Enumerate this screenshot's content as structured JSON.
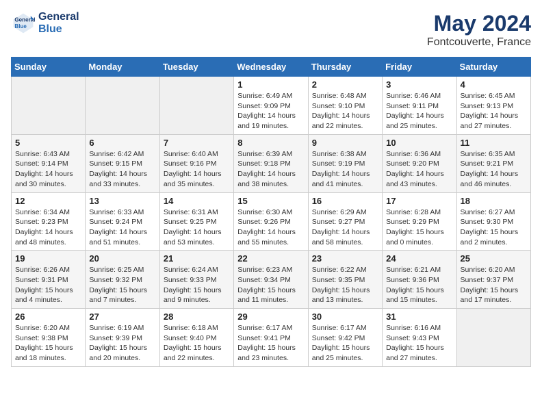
{
  "header": {
    "logo_line1": "General",
    "logo_line2": "Blue",
    "month_year": "May 2024",
    "location": "Fontcouverte, France"
  },
  "days_of_week": [
    "Sunday",
    "Monday",
    "Tuesday",
    "Wednesday",
    "Thursday",
    "Friday",
    "Saturday"
  ],
  "weeks": [
    [
      {
        "day": "",
        "sunrise": "",
        "sunset": "",
        "daylight": ""
      },
      {
        "day": "",
        "sunrise": "",
        "sunset": "",
        "daylight": ""
      },
      {
        "day": "",
        "sunrise": "",
        "sunset": "",
        "daylight": ""
      },
      {
        "day": "1",
        "sunrise": "Sunrise: 6:49 AM",
        "sunset": "Sunset: 9:09 PM",
        "daylight": "Daylight: 14 hours and 19 minutes."
      },
      {
        "day": "2",
        "sunrise": "Sunrise: 6:48 AM",
        "sunset": "Sunset: 9:10 PM",
        "daylight": "Daylight: 14 hours and 22 minutes."
      },
      {
        "day": "3",
        "sunrise": "Sunrise: 6:46 AM",
        "sunset": "Sunset: 9:11 PM",
        "daylight": "Daylight: 14 hours and 25 minutes."
      },
      {
        "day": "4",
        "sunrise": "Sunrise: 6:45 AM",
        "sunset": "Sunset: 9:13 PM",
        "daylight": "Daylight: 14 hours and 27 minutes."
      }
    ],
    [
      {
        "day": "5",
        "sunrise": "Sunrise: 6:43 AM",
        "sunset": "Sunset: 9:14 PM",
        "daylight": "Daylight: 14 hours and 30 minutes."
      },
      {
        "day": "6",
        "sunrise": "Sunrise: 6:42 AM",
        "sunset": "Sunset: 9:15 PM",
        "daylight": "Daylight: 14 hours and 33 minutes."
      },
      {
        "day": "7",
        "sunrise": "Sunrise: 6:40 AM",
        "sunset": "Sunset: 9:16 PM",
        "daylight": "Daylight: 14 hours and 35 minutes."
      },
      {
        "day": "8",
        "sunrise": "Sunrise: 6:39 AM",
        "sunset": "Sunset: 9:18 PM",
        "daylight": "Daylight: 14 hours and 38 minutes."
      },
      {
        "day": "9",
        "sunrise": "Sunrise: 6:38 AM",
        "sunset": "Sunset: 9:19 PM",
        "daylight": "Daylight: 14 hours and 41 minutes."
      },
      {
        "day": "10",
        "sunrise": "Sunrise: 6:36 AM",
        "sunset": "Sunset: 9:20 PM",
        "daylight": "Daylight: 14 hours and 43 minutes."
      },
      {
        "day": "11",
        "sunrise": "Sunrise: 6:35 AM",
        "sunset": "Sunset: 9:21 PM",
        "daylight": "Daylight: 14 hours and 46 minutes."
      }
    ],
    [
      {
        "day": "12",
        "sunrise": "Sunrise: 6:34 AM",
        "sunset": "Sunset: 9:23 PM",
        "daylight": "Daylight: 14 hours and 48 minutes."
      },
      {
        "day": "13",
        "sunrise": "Sunrise: 6:33 AM",
        "sunset": "Sunset: 9:24 PM",
        "daylight": "Daylight: 14 hours and 51 minutes."
      },
      {
        "day": "14",
        "sunrise": "Sunrise: 6:31 AM",
        "sunset": "Sunset: 9:25 PM",
        "daylight": "Daylight: 14 hours and 53 minutes."
      },
      {
        "day": "15",
        "sunrise": "Sunrise: 6:30 AM",
        "sunset": "Sunset: 9:26 PM",
        "daylight": "Daylight: 14 hours and 55 minutes."
      },
      {
        "day": "16",
        "sunrise": "Sunrise: 6:29 AM",
        "sunset": "Sunset: 9:27 PM",
        "daylight": "Daylight: 14 hours and 58 minutes."
      },
      {
        "day": "17",
        "sunrise": "Sunrise: 6:28 AM",
        "sunset": "Sunset: 9:29 PM",
        "daylight": "Daylight: 15 hours and 0 minutes."
      },
      {
        "day": "18",
        "sunrise": "Sunrise: 6:27 AM",
        "sunset": "Sunset: 9:30 PM",
        "daylight": "Daylight: 15 hours and 2 minutes."
      }
    ],
    [
      {
        "day": "19",
        "sunrise": "Sunrise: 6:26 AM",
        "sunset": "Sunset: 9:31 PM",
        "daylight": "Daylight: 15 hours and 4 minutes."
      },
      {
        "day": "20",
        "sunrise": "Sunrise: 6:25 AM",
        "sunset": "Sunset: 9:32 PM",
        "daylight": "Daylight: 15 hours and 7 minutes."
      },
      {
        "day": "21",
        "sunrise": "Sunrise: 6:24 AM",
        "sunset": "Sunset: 9:33 PM",
        "daylight": "Daylight: 15 hours and 9 minutes."
      },
      {
        "day": "22",
        "sunrise": "Sunrise: 6:23 AM",
        "sunset": "Sunset: 9:34 PM",
        "daylight": "Daylight: 15 hours and 11 minutes."
      },
      {
        "day": "23",
        "sunrise": "Sunrise: 6:22 AM",
        "sunset": "Sunset: 9:35 PM",
        "daylight": "Daylight: 15 hours and 13 minutes."
      },
      {
        "day": "24",
        "sunrise": "Sunrise: 6:21 AM",
        "sunset": "Sunset: 9:36 PM",
        "daylight": "Daylight: 15 hours and 15 minutes."
      },
      {
        "day": "25",
        "sunrise": "Sunrise: 6:20 AM",
        "sunset": "Sunset: 9:37 PM",
        "daylight": "Daylight: 15 hours and 17 minutes."
      }
    ],
    [
      {
        "day": "26",
        "sunrise": "Sunrise: 6:20 AM",
        "sunset": "Sunset: 9:38 PM",
        "daylight": "Daylight: 15 hours and 18 minutes."
      },
      {
        "day": "27",
        "sunrise": "Sunrise: 6:19 AM",
        "sunset": "Sunset: 9:39 PM",
        "daylight": "Daylight: 15 hours and 20 minutes."
      },
      {
        "day": "28",
        "sunrise": "Sunrise: 6:18 AM",
        "sunset": "Sunset: 9:40 PM",
        "daylight": "Daylight: 15 hours and 22 minutes."
      },
      {
        "day": "29",
        "sunrise": "Sunrise: 6:17 AM",
        "sunset": "Sunset: 9:41 PM",
        "daylight": "Daylight: 15 hours and 23 minutes."
      },
      {
        "day": "30",
        "sunrise": "Sunrise: 6:17 AM",
        "sunset": "Sunset: 9:42 PM",
        "daylight": "Daylight: 15 hours and 25 minutes."
      },
      {
        "day": "31",
        "sunrise": "Sunrise: 6:16 AM",
        "sunset": "Sunset: 9:43 PM",
        "daylight": "Daylight: 15 hours and 27 minutes."
      },
      {
        "day": "",
        "sunrise": "",
        "sunset": "",
        "daylight": ""
      }
    ]
  ]
}
